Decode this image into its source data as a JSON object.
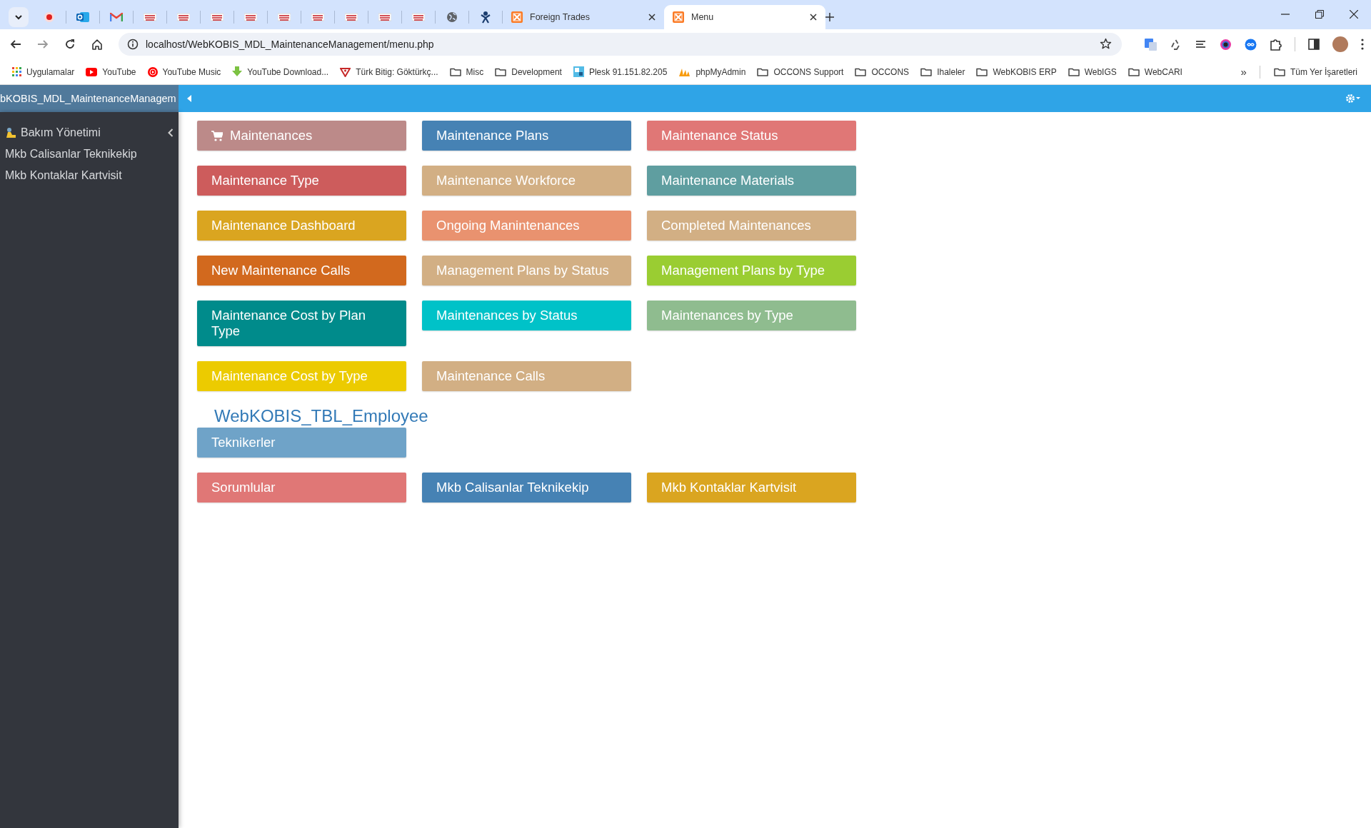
{
  "browser": {
    "tabs": [
      {
        "kind": "record",
        "selected": false
      },
      {
        "kind": "outlook",
        "selected": false
      },
      {
        "kind": "mail",
        "selected": false
      },
      {
        "kind": "site",
        "selected": false
      },
      {
        "kind": "site",
        "selected": false
      },
      {
        "kind": "site",
        "selected": false
      },
      {
        "kind": "site",
        "selected": false
      },
      {
        "kind": "site",
        "selected": false
      },
      {
        "kind": "site",
        "selected": false
      },
      {
        "kind": "site",
        "selected": false
      },
      {
        "kind": "site",
        "selected": false
      },
      {
        "kind": "site",
        "selected": false
      },
      {
        "kind": "globe",
        "selected": false
      },
      {
        "kind": "figure",
        "selected": false
      },
      {
        "kind": "xampp",
        "title": "Foreign Trades",
        "selected": false
      },
      {
        "kind": "xampp",
        "title": "Menu",
        "selected": true
      }
    ],
    "url": "localhost/WebKOBIS_MDL_MaintenanceManagement/menu.php",
    "bookmarks": [
      {
        "kind": "apps",
        "label": "Uygulamalar"
      },
      {
        "kind": "youtube",
        "label": "YouTube"
      },
      {
        "kind": "ytmusic",
        "label": "YouTube Music"
      },
      {
        "kind": "download",
        "label": "YouTube Download..."
      },
      {
        "kind": "bitig",
        "label": "Türk Bitig: Göktürkç..."
      },
      {
        "kind": "folder",
        "label": "Misc"
      },
      {
        "kind": "folder",
        "label": "Development"
      },
      {
        "kind": "plesk",
        "label": "Plesk 91.151.82.205"
      },
      {
        "kind": "pma",
        "label": "phpMyAdmin"
      },
      {
        "kind": "folder",
        "label": "OCCONS Support"
      },
      {
        "kind": "folder",
        "label": "OCCONS"
      },
      {
        "kind": "folder",
        "label": "Ihaleler"
      },
      {
        "kind": "folder",
        "label": "WebKOBIS ERP"
      },
      {
        "kind": "folder",
        "label": "WebIGS"
      },
      {
        "kind": "folder",
        "label": "WebCARI"
      }
    ],
    "bookmarks_overflow": "»",
    "all_bookmarks": "Tüm Yer İşaretleri"
  },
  "app": {
    "title": "bKOBIS_MDL_MaintenanceManagem",
    "sidebar": {
      "items": [
        {
          "kind": "group",
          "label": "Bakım Yönetimi",
          "expanded": false
        },
        {
          "kind": "link",
          "label": "Mkb Calisanlar Teknikekip"
        },
        {
          "kind": "link",
          "label": "Mkb Kontaklar Kartvisit"
        }
      ]
    },
    "sections": [
      {
        "buttons": [
          {
            "kind": "cart",
            "label": "Maintenances",
            "color": "#bc8a89"
          },
          {
            "kind": "plain",
            "label": "Maintenance Plans",
            "color": "#4682b4"
          },
          {
            "kind": "plain",
            "label": "Maintenance Status",
            "color": "#e07776"
          },
          {
            "kind": "plain",
            "label": "Maintenance Type",
            "color": "#cd5c5c"
          },
          {
            "kind": "plain",
            "label": "Maintenance Workforce",
            "color": "#d2af84"
          },
          {
            "kind": "plain",
            "label": "Maintenance Materials",
            "color": "#5f9ea0"
          },
          {
            "kind": "plain",
            "label": "Maintenance Dashboard",
            "color": "#daa520"
          },
          {
            "kind": "plain",
            "label": "Ongoing Manintenances",
            "color": "#e9926f"
          },
          {
            "kind": "plain",
            "label": "Completed Maintenances",
            "color": "#d2af84"
          },
          {
            "kind": "plain",
            "label": "New Maintenance Calls",
            "color": "#d2691e"
          },
          {
            "kind": "plain",
            "label": "Management Plans by Status",
            "color": "#d2af84"
          },
          {
            "kind": "plain",
            "label": "Management Plans by Type",
            "color": "#9acd32"
          },
          {
            "kind": "plain",
            "label": "Maintenance Cost by Plan Type",
            "color": "#008b8b"
          },
          {
            "kind": "plain",
            "label": "Maintenances by Status",
            "color": "#00c2c8"
          },
          {
            "kind": "plain",
            "label": "Maintenances by Type",
            "color": "#8fbc8f"
          },
          {
            "kind": "plain",
            "label": "Maintenance Cost by Type",
            "color": "#eccb00"
          },
          {
            "kind": "plain",
            "label": "Maintenance Calls",
            "color": "#d2af84"
          }
        ]
      },
      {
        "heading": "WebKOBIS_TBL_Employee",
        "buttons": [
          {
            "kind": "plain",
            "label": "Teknikerler",
            "color": "#6fa3c8"
          }
        ]
      },
      {
        "buttons": [
          {
            "kind": "plain",
            "label": "Sorumlular",
            "color": "#e07776"
          },
          {
            "kind": "plain",
            "label": "Mkb Calisanlar Teknikekip",
            "color": "#4682b4"
          },
          {
            "kind": "plain",
            "label": "Mkb Kontaklar Kartvisit",
            "color": "#daa520"
          }
        ]
      }
    ]
  }
}
